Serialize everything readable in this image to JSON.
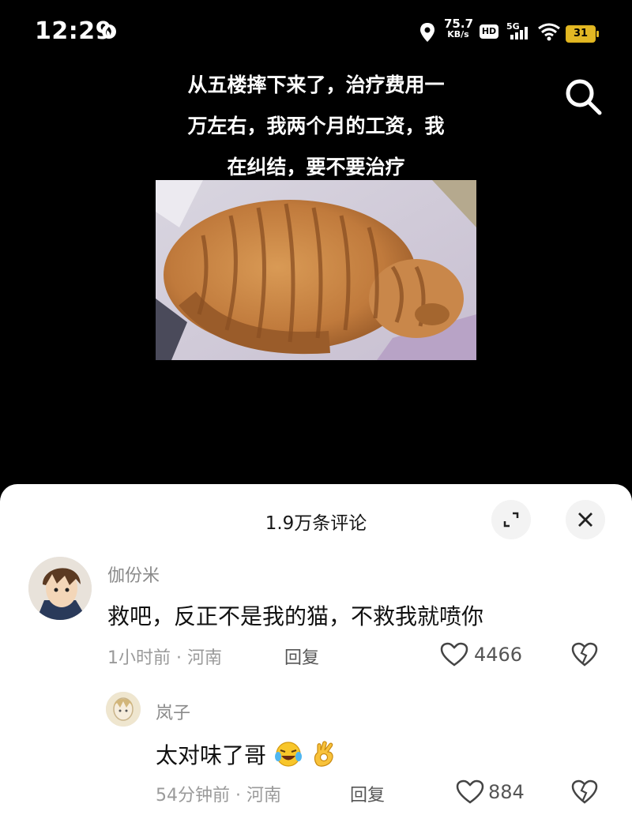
{
  "status_bar": {
    "time": "12:29",
    "speed_value": "75.7",
    "speed_unit": "KB/s",
    "hd": "HD",
    "network": "5G",
    "battery": "31"
  },
  "video": {
    "caption_lines": [
      "从五楼摔下来了，治疗费用一",
      "万左右，我两个月的工资，我",
      "在纠结，要不要治疗"
    ]
  },
  "comments_panel": {
    "title": "1.9万条评论",
    "comments": [
      {
        "username": "伽份米",
        "text": "救吧，反正不是我的猫，不救我就喷你",
        "meta": "1小时前 · 河南",
        "reply_label": "回复",
        "likes": "4466"
      },
      {
        "username": "岚子",
        "text": "太对味了哥",
        "meta": "54分钟前 · 河南",
        "reply_label": "回复",
        "likes": "884"
      }
    ]
  },
  "colors": {
    "background": "#000000",
    "sheet": "#ffffff",
    "battery": "#e3b824"
  }
}
